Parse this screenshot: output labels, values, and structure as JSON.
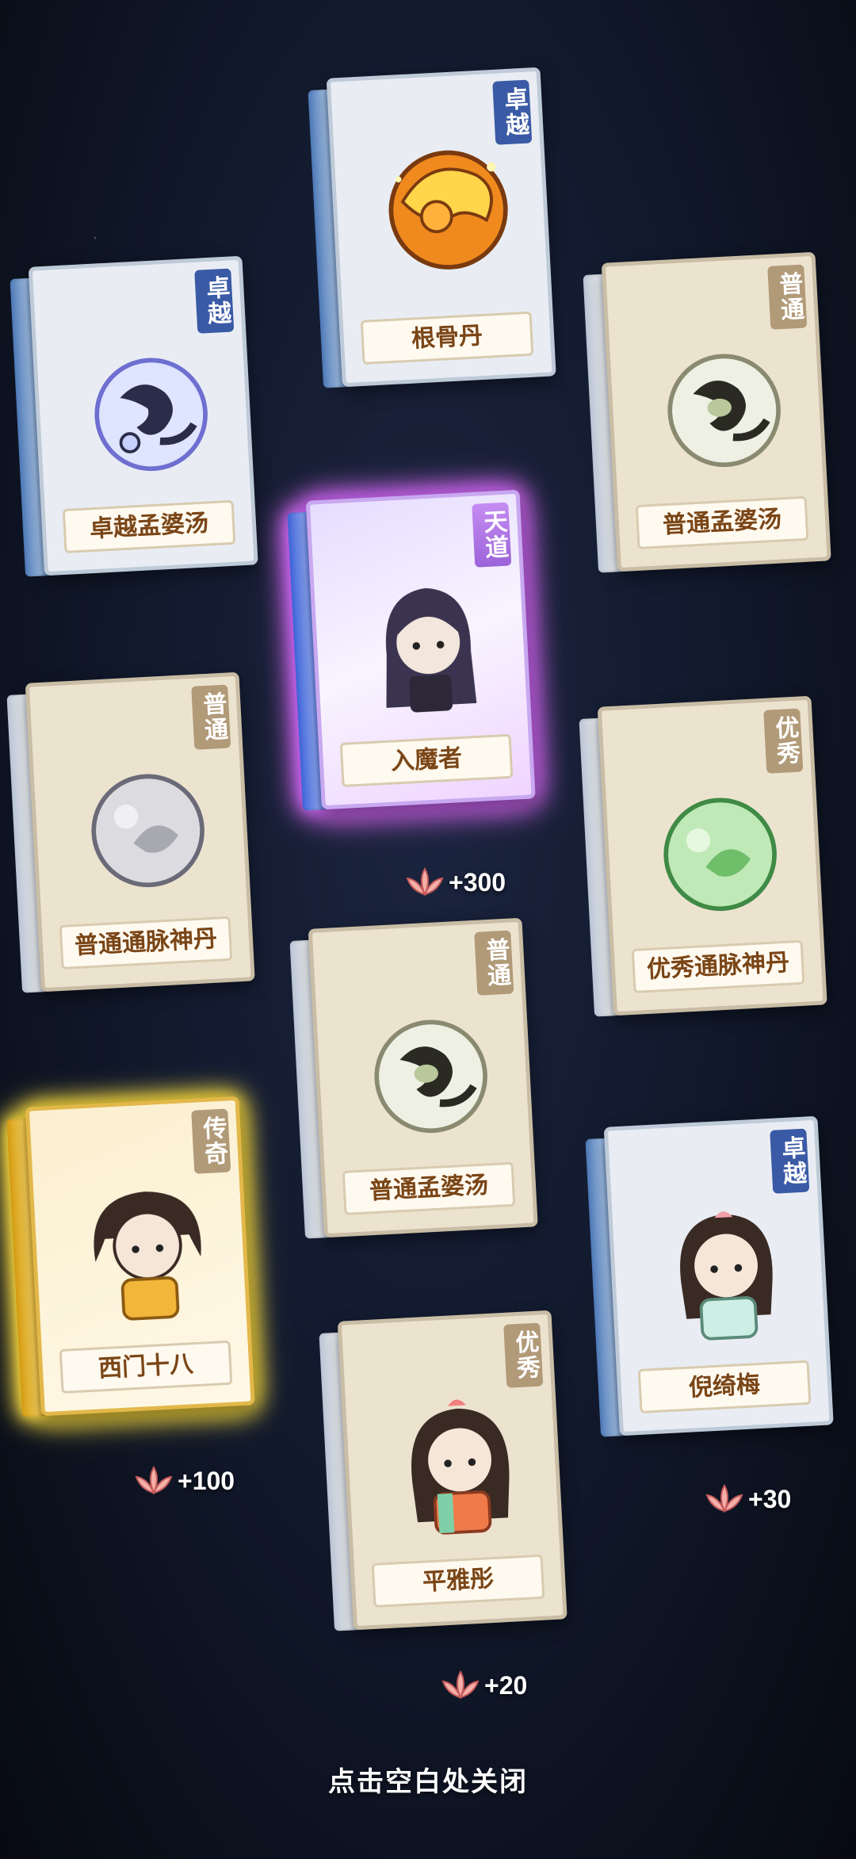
{
  "cards": [
    {
      "id": "c1",
      "rarity": "卓越",
      "name": "根骨丹",
      "icon": "golden-pill-icon",
      "theme": "zhuoyue"
    },
    {
      "id": "c2",
      "rarity": "卓越",
      "name": "卓越孟婆汤",
      "icon": "soup-orb-icon",
      "theme": "zhuoyue"
    },
    {
      "id": "c3",
      "rarity": "普通",
      "name": "普通孟婆汤",
      "icon": "soup-orb-icon",
      "theme": "putong"
    },
    {
      "id": "c4",
      "rarity": "天道",
      "name": "入魔者",
      "icon": "character-portrait-icon",
      "theme": "tiandao",
      "reward": "+300"
    },
    {
      "id": "c5",
      "rarity": "普通",
      "name": "普通通脉神丹",
      "icon": "silver-pill-icon",
      "theme": "putong"
    },
    {
      "id": "c6",
      "rarity": "优秀",
      "name": "优秀通脉神丹",
      "icon": "green-pill-icon",
      "theme": "youxiu"
    },
    {
      "id": "c7",
      "rarity": "普通",
      "name": "普通孟婆汤",
      "icon": "soup-orb-icon",
      "theme": "putong"
    },
    {
      "id": "c8",
      "rarity": "传奇",
      "name": "西门十八",
      "icon": "character-portrait-icon",
      "theme": "chuanqi",
      "reward": "+100"
    },
    {
      "id": "c9",
      "rarity": "卓越",
      "name": "倪绮梅",
      "icon": "character-portrait-icon",
      "theme": "zhuoyue",
      "reward": "+30"
    },
    {
      "id": "c10",
      "rarity": "优秀",
      "name": "平雅彤",
      "icon": "character-portrait-icon",
      "theme": "youxiu",
      "reward": "+20"
    }
  ],
  "reward_icon": "lotus-icon",
  "close_hint": "点击空白处关闭",
  "colors": {
    "zhuoyue": "#3a5aa6",
    "putong": "#b19a78",
    "tiandao": "#b37be6",
    "chuanqi": "#ffd21f",
    "name_text": "#7a4516"
  }
}
